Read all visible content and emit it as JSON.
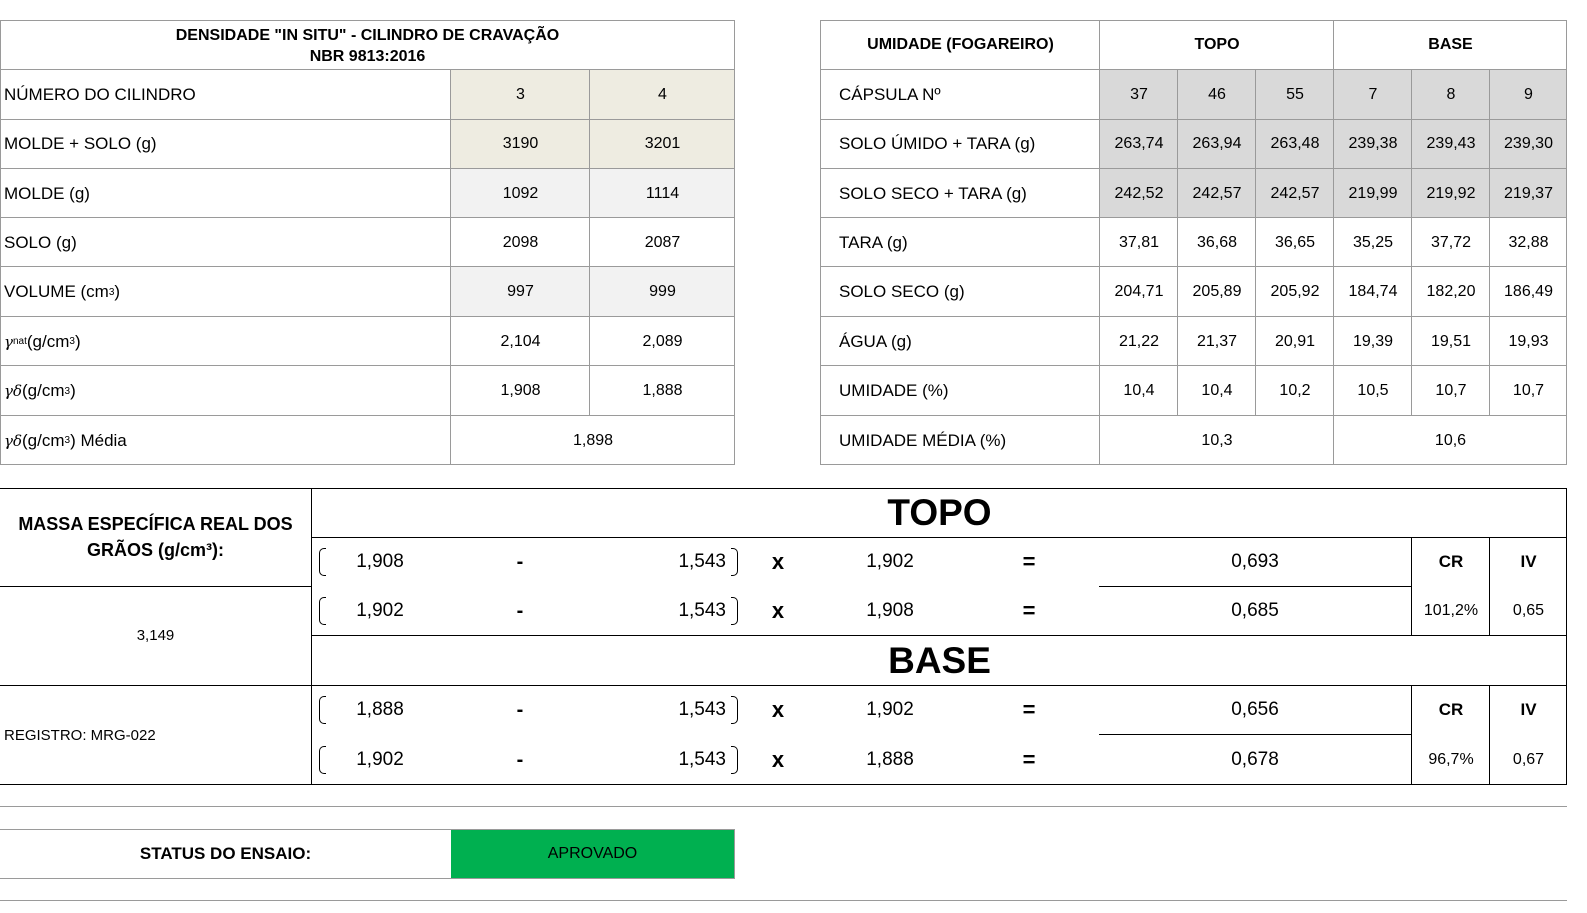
{
  "density": {
    "title1": "DENSIDADE \"IN SITU\" - CILINDRO DE CRAVAÇÃO",
    "title2": "NBR 9813:2016",
    "rows": [
      {
        "label": "NÚMERO DO CILINDRO",
        "v1": "3",
        "v2": "4"
      },
      {
        "label": "MOLDE + SOLO (g)",
        "v1": "3190",
        "v2": "3201"
      },
      {
        "label": "MOLDE (g)",
        "v1": "1092",
        "v2": "1114"
      },
      {
        "label": "SOLO (g)",
        "v1": "2098",
        "v2": "2087"
      },
      {
        "label_pre": "VOLUME (cm",
        "label_sup": "3",
        "label_post": ")",
        "v1": "997",
        "v2": "999"
      },
      {
        "gamma": "γ",
        "sub": "nat",
        "label_pre": " (g/cm",
        "label_sup": "3",
        "label_post": ")",
        "v1": "2,104",
        "v2": "2,089"
      },
      {
        "gamma": "γδ",
        "label_pre": " (g/cm",
        "label_sup": "3",
        "label_post": ")",
        "v1": "1,908",
        "v2": "1,888"
      }
    ],
    "media": {
      "gamma": "γδ",
      "label_pre": " (g/cm",
      "label_sup": "3",
      "label_post": ") Média",
      "value": "1,898"
    }
  },
  "moisture": {
    "title": "UMIDADE (FOGAREIRO)",
    "topo": "TOPO",
    "base": "BASE",
    "rows": [
      {
        "label": "CÁPSULA Nº",
        "vals": [
          "37",
          "46",
          "55",
          "7",
          "8",
          "9"
        ]
      },
      {
        "label": "SOLO ÚMIDO + TARA (g)",
        "vals": [
          "263,74",
          "263,94",
          "263,48",
          "239,38",
          "239,43",
          "239,30"
        ]
      },
      {
        "label": "SOLO SECO + TARA (g)",
        "vals": [
          "242,52",
          "242,57",
          "242,57",
          "219,99",
          "219,92",
          "219,37"
        ]
      },
      {
        "label": "TARA (g)",
        "vals": [
          "37,81",
          "36,68",
          "36,65",
          "35,25",
          "37,72",
          "32,88"
        ]
      },
      {
        "label": "SOLO SECO (g)",
        "vals": [
          "204,71",
          "205,89",
          "205,92",
          "184,74",
          "182,20",
          "186,49"
        ]
      },
      {
        "label": "ÁGUA (g)",
        "vals": [
          "21,22",
          "21,37",
          "20,91",
          "19,39",
          "19,51",
          "19,93"
        ]
      },
      {
        "label": "UMIDADE (%)",
        "vals": [
          "10,4",
          "10,4",
          "10,2",
          "10,5",
          "10,7",
          "10,7"
        ]
      }
    ],
    "media_label": "UMIDADE MÉDIA (%)",
    "media_topo": "10,3",
    "media_base": "10,6"
  },
  "massa": {
    "label": "MASSA ESPECÍFICA REAL DOS GRÃOS (g/cm³):",
    "value": "3,149",
    "registro": "REGISTRO: MRG-022"
  },
  "calc": {
    "minus": "-",
    "times": "x",
    "equals": "=",
    "cr": "CR",
    "iv": "IV",
    "topo": {
      "title": "TOPO",
      "rows": [
        {
          "a": "1,908",
          "b": "1,543",
          "c": "1,902",
          "r": "0,693"
        },
        {
          "a": "1,902",
          "b": "1,543",
          "c": "1,908",
          "r": "0,685"
        }
      ],
      "cr_value": "101,2%",
      "iv_value": "0,65"
    },
    "base": {
      "title": "BASE",
      "rows": [
        {
          "a": "1,888",
          "b": "1,543",
          "c": "1,902",
          "r": "0,656"
        },
        {
          "a": "1,902",
          "b": "1,543",
          "c": "1,888",
          "r": "0,678"
        }
      ],
      "cr_value": "96,7%",
      "iv_value": "0,67"
    }
  },
  "status": {
    "label": "STATUS DO ENSAIO:",
    "value": "APROVADO",
    "color": "#00b050"
  }
}
